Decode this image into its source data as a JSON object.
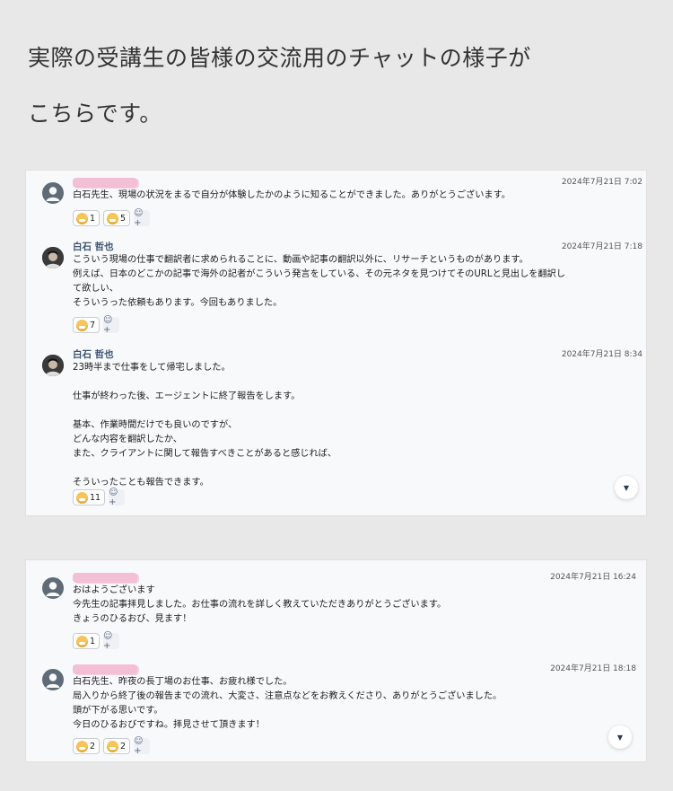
{
  "heading": {
    "line1": "実際の受講生の皆様の交流用のチャットの様子が",
    "line2": "こちらです。"
  },
  "panel1": {
    "messages": [
      {
        "name": "",
        "time": "2024年7月21日 7:02",
        "lines": [
          "白石先生、現場の状況をまるで自分が体験したかのように知ることができました。ありがとうございます。"
        ],
        "reactions": [
          {
            "emoji": "grin-face",
            "count": "1"
          },
          {
            "emoji": "grin-face",
            "count": "5"
          }
        ]
      },
      {
        "name": "白石 哲也",
        "time": "2024年7月21日 7:18",
        "lines": [
          "こういう現場の仕事で翻訳者に求められることに、動画や記事の翻訳以外に、リサーチというものがあります。",
          "例えば、日本のどこかの記事で海外の記者がこういう発言をしている、その元ネタを見つけてそのURLと見出しを翻訳し",
          "て欲しい、",
          "そういうった依頼もあります。今回もありました。"
        ],
        "reactions": [
          {
            "emoji": "grin-face",
            "count": "7"
          }
        ]
      },
      {
        "name": "白石 哲也",
        "time": "2024年7月21日 8:34",
        "lines": [
          "23時半まで仕事をして帰宅しました。",
          "",
          "仕事が終わった後、エージェントに終了報告をします。",
          "",
          "基本、作業時間だけでも良いのですが、",
          "どんな内容を翻訳したか、",
          "また、クライアントに関して報告すべきことがあると感じれば、",
          "",
          "そういったことも報告できます。"
        ],
        "reactions": [
          {
            "emoji": "grin-face",
            "count": "11"
          }
        ]
      }
    ]
  },
  "panel2": {
    "messages": [
      {
        "name": "",
        "time": "2024年7月21日 16:24",
        "lines": [
          "おはようございます",
          "今先生の記事拝見しました。お仕事の流れを詳しく教えていただきありがとうございます。",
          "きょうのひるおび、見ます！"
        ],
        "reactions": [
          {
            "emoji": "grin-face",
            "count": "1"
          }
        ]
      },
      {
        "name": "",
        "time": "2024年7月21日 18:18",
        "lines": [
          "白石先生、昨夜の長丁場のお仕事、お疲れ様でした。",
          "局入りから終了後の報告までの流れ、大変さ、注意点などをお教えくださり、ありがとうございました。",
          "頭が下がる思いです。",
          "今日のひるおびですね。拝見させて頂きます！"
        ],
        "reactions": [
          {
            "emoji": "grin-face",
            "count": "2"
          },
          {
            "emoji": "grin-face",
            "count": "2"
          }
        ]
      }
    ]
  },
  "icons": {
    "add_reaction": "add-reaction-icon",
    "scroll_down": "chevron-down-icon"
  }
}
